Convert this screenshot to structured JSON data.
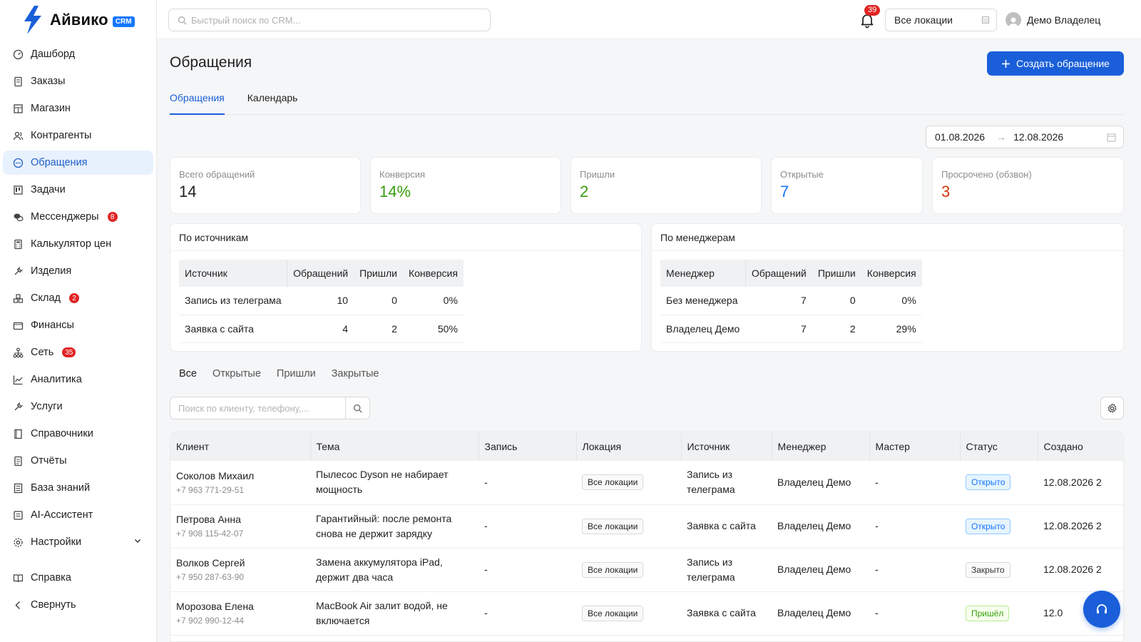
{
  "brand": {
    "name": "Айвико",
    "badge": "CRM",
    "accent": "#1a5fd9"
  },
  "sidebar": {
    "items": [
      {
        "label": "Дашборд",
        "icon": "dashboard-icon"
      },
      {
        "label": "Заказы",
        "icon": "document-icon"
      },
      {
        "label": "Магазин",
        "icon": "store-icon"
      },
      {
        "label": "Контрагенты",
        "icon": "contacts-icon"
      },
      {
        "label": "Обращения",
        "icon": "chat-icon",
        "active": true
      },
      {
        "label": "Задачи",
        "icon": "kanban-icon"
      },
      {
        "label": "Мессенджеры",
        "icon": "messengers-icon",
        "badge": "8"
      },
      {
        "label": "Калькулятор цен",
        "icon": "calculator-icon"
      },
      {
        "label": "Изделия",
        "icon": "wrench-icon"
      },
      {
        "label": "Склад",
        "icon": "boxes-icon",
        "badge": "2"
      },
      {
        "label": "Финансы",
        "icon": "wallet-icon"
      },
      {
        "label": "Сеть",
        "icon": "network-icon",
        "badge": "35"
      },
      {
        "label": "Аналитика",
        "icon": "chart-line-icon"
      },
      {
        "label": "Услуги",
        "icon": "tool-icon"
      },
      {
        "label": "Справочники",
        "icon": "book-icon"
      },
      {
        "label": "Отчёты",
        "icon": "report-icon"
      },
      {
        "label": "База знаний",
        "icon": "knowledge-icon"
      },
      {
        "label": "AI-Ассистент",
        "icon": "ai-icon"
      },
      {
        "label": "Настройки",
        "icon": "gear-icon"
      }
    ],
    "help": "Справка",
    "collapse": "Свернуть"
  },
  "header": {
    "search_placeholder": "Быстрый поиск по CRM...",
    "notifications": "39",
    "location": "Все локации",
    "user": "Демо Владелец"
  },
  "page": {
    "title": "Обращения",
    "create_label": "Создать обращение",
    "tabs": [
      "Обращения",
      "Календарь"
    ],
    "date_from": "01.08.2026",
    "date_to": "12.08.2026"
  },
  "kpis": [
    {
      "label": "Всего обращений",
      "value": "14",
      "color": "#1f1f1f"
    },
    {
      "label": "Конверсия",
      "value": "14%",
      "color": "#389e0d"
    },
    {
      "label": "Пришли",
      "value": "2",
      "color": "#389e0d"
    },
    {
      "label": "Открытые",
      "value": "7",
      "color": "#1677ff"
    },
    {
      "label": "Просрочено (обзвон)",
      "value": "3",
      "color": "#d4380d"
    }
  ],
  "sources": {
    "title": "По источникам",
    "headers": [
      "Источник",
      "Обращений",
      "Пришли",
      "Конверсия"
    ],
    "rows": [
      [
        "Запись из телеграма",
        "10",
        "0",
        "0%"
      ],
      [
        "Заявка с сайта",
        "4",
        "2",
        "50%"
      ]
    ]
  },
  "managers": {
    "title": "По менеджерам",
    "headers": [
      "Менеджер",
      "Обращений",
      "Пришли",
      "Конверсия"
    ],
    "rows": [
      [
        "Без менеджера",
        "7",
        "0",
        "0%"
      ],
      [
        "Владелец Демо",
        "7",
        "2",
        "29%"
      ]
    ]
  },
  "filters": [
    "Все",
    "Открытые",
    "Пришли",
    "Закрытые"
  ],
  "table": {
    "search_placeholder": "Поиск по клиенту, телефону,...",
    "headers": [
      "Клиент",
      "Тема",
      "Запись",
      "Локация",
      "Источник",
      "Менеджер",
      "Мастер",
      "Статус",
      "Создано"
    ],
    "rows": [
      {
        "client": "Соколов Михаил",
        "phone": "+7 963 771-29-51",
        "topic": "Пылесос Dyson не набирает мощность",
        "record": "-",
        "location": "Все локации",
        "source": "Запись из телеграма",
        "manager": "Владелец Демо",
        "master": "-",
        "status": "Открыто",
        "status_kind": "open",
        "created": "12.08.2026 2"
      },
      {
        "client": "Петрова Анна",
        "phone": "+7 908 115-42-07",
        "topic": "Гарантийный: после ремонта снова не держит зарядку",
        "record": "-",
        "location": "Все локации",
        "source": "Заявка с сайта",
        "manager": "Владелец Демо",
        "master": "-",
        "status": "Открыто",
        "status_kind": "open",
        "created": "12.08.2026 2"
      },
      {
        "client": "Волков Сергей",
        "phone": "+7 950 287-63-90",
        "topic": "Замена аккумулятора iPad, держит два часа",
        "record": "-",
        "location": "Все локации",
        "source": "Запись из телеграма",
        "manager": "Владелец Демо",
        "master": "-",
        "status": "Закрыто",
        "status_kind": "closed",
        "created": "12.08.2026 2"
      },
      {
        "client": "Морозова Елена",
        "phone": "+7 902 990-12-44",
        "topic": "MacBook Air залит водой, не включается",
        "record": "-",
        "location": "Все локации",
        "source": "Заявка с сайта",
        "manager": "Владелец Демо",
        "master": "-",
        "status": "Пришёл",
        "status_kind": "came",
        "created": "12.0"
      }
    ]
  }
}
